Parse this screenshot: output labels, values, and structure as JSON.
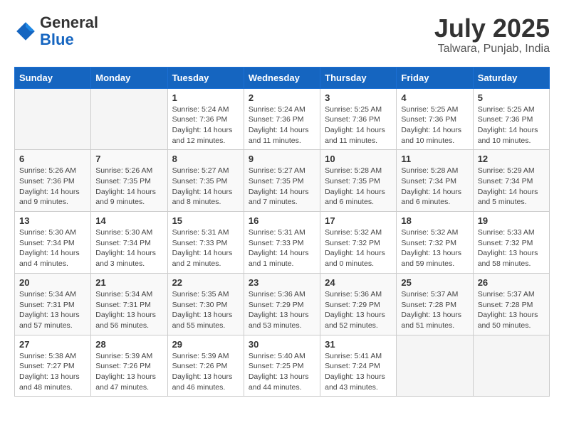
{
  "header": {
    "logo_line1": "General",
    "logo_line2": "Blue",
    "title": "July 2025",
    "location": "Talwara, Punjab, India"
  },
  "weekdays": [
    "Sunday",
    "Monday",
    "Tuesday",
    "Wednesday",
    "Thursday",
    "Friday",
    "Saturday"
  ],
  "weeks": [
    [
      {
        "day": "",
        "info": ""
      },
      {
        "day": "",
        "info": ""
      },
      {
        "day": "1",
        "info": "Sunrise: 5:24 AM\nSunset: 7:36 PM\nDaylight: 14 hours and 12 minutes."
      },
      {
        "day": "2",
        "info": "Sunrise: 5:24 AM\nSunset: 7:36 PM\nDaylight: 14 hours and 11 minutes."
      },
      {
        "day": "3",
        "info": "Sunrise: 5:25 AM\nSunset: 7:36 PM\nDaylight: 14 hours and 11 minutes."
      },
      {
        "day": "4",
        "info": "Sunrise: 5:25 AM\nSunset: 7:36 PM\nDaylight: 14 hours and 10 minutes."
      },
      {
        "day": "5",
        "info": "Sunrise: 5:25 AM\nSunset: 7:36 PM\nDaylight: 14 hours and 10 minutes."
      }
    ],
    [
      {
        "day": "6",
        "info": "Sunrise: 5:26 AM\nSunset: 7:36 PM\nDaylight: 14 hours and 9 minutes."
      },
      {
        "day": "7",
        "info": "Sunrise: 5:26 AM\nSunset: 7:35 PM\nDaylight: 14 hours and 9 minutes."
      },
      {
        "day": "8",
        "info": "Sunrise: 5:27 AM\nSunset: 7:35 PM\nDaylight: 14 hours and 8 minutes."
      },
      {
        "day": "9",
        "info": "Sunrise: 5:27 AM\nSunset: 7:35 PM\nDaylight: 14 hours and 7 minutes."
      },
      {
        "day": "10",
        "info": "Sunrise: 5:28 AM\nSunset: 7:35 PM\nDaylight: 14 hours and 6 minutes."
      },
      {
        "day": "11",
        "info": "Sunrise: 5:28 AM\nSunset: 7:34 PM\nDaylight: 14 hours and 6 minutes."
      },
      {
        "day": "12",
        "info": "Sunrise: 5:29 AM\nSunset: 7:34 PM\nDaylight: 14 hours and 5 minutes."
      }
    ],
    [
      {
        "day": "13",
        "info": "Sunrise: 5:30 AM\nSunset: 7:34 PM\nDaylight: 14 hours and 4 minutes."
      },
      {
        "day": "14",
        "info": "Sunrise: 5:30 AM\nSunset: 7:34 PM\nDaylight: 14 hours and 3 minutes."
      },
      {
        "day": "15",
        "info": "Sunrise: 5:31 AM\nSunset: 7:33 PM\nDaylight: 14 hours and 2 minutes."
      },
      {
        "day": "16",
        "info": "Sunrise: 5:31 AM\nSunset: 7:33 PM\nDaylight: 14 hours and 1 minute."
      },
      {
        "day": "17",
        "info": "Sunrise: 5:32 AM\nSunset: 7:32 PM\nDaylight: 14 hours and 0 minutes."
      },
      {
        "day": "18",
        "info": "Sunrise: 5:32 AM\nSunset: 7:32 PM\nDaylight: 13 hours and 59 minutes."
      },
      {
        "day": "19",
        "info": "Sunrise: 5:33 AM\nSunset: 7:32 PM\nDaylight: 13 hours and 58 minutes."
      }
    ],
    [
      {
        "day": "20",
        "info": "Sunrise: 5:34 AM\nSunset: 7:31 PM\nDaylight: 13 hours and 57 minutes."
      },
      {
        "day": "21",
        "info": "Sunrise: 5:34 AM\nSunset: 7:31 PM\nDaylight: 13 hours and 56 minutes."
      },
      {
        "day": "22",
        "info": "Sunrise: 5:35 AM\nSunset: 7:30 PM\nDaylight: 13 hours and 55 minutes."
      },
      {
        "day": "23",
        "info": "Sunrise: 5:36 AM\nSunset: 7:29 PM\nDaylight: 13 hours and 53 minutes."
      },
      {
        "day": "24",
        "info": "Sunrise: 5:36 AM\nSunset: 7:29 PM\nDaylight: 13 hours and 52 minutes."
      },
      {
        "day": "25",
        "info": "Sunrise: 5:37 AM\nSunset: 7:28 PM\nDaylight: 13 hours and 51 minutes."
      },
      {
        "day": "26",
        "info": "Sunrise: 5:37 AM\nSunset: 7:28 PM\nDaylight: 13 hours and 50 minutes."
      }
    ],
    [
      {
        "day": "27",
        "info": "Sunrise: 5:38 AM\nSunset: 7:27 PM\nDaylight: 13 hours and 48 minutes."
      },
      {
        "day": "28",
        "info": "Sunrise: 5:39 AM\nSunset: 7:26 PM\nDaylight: 13 hours and 47 minutes."
      },
      {
        "day": "29",
        "info": "Sunrise: 5:39 AM\nSunset: 7:26 PM\nDaylight: 13 hours and 46 minutes."
      },
      {
        "day": "30",
        "info": "Sunrise: 5:40 AM\nSunset: 7:25 PM\nDaylight: 13 hours and 44 minutes."
      },
      {
        "day": "31",
        "info": "Sunrise: 5:41 AM\nSunset: 7:24 PM\nDaylight: 13 hours and 43 minutes."
      },
      {
        "day": "",
        "info": ""
      },
      {
        "day": "",
        "info": ""
      }
    ]
  ]
}
